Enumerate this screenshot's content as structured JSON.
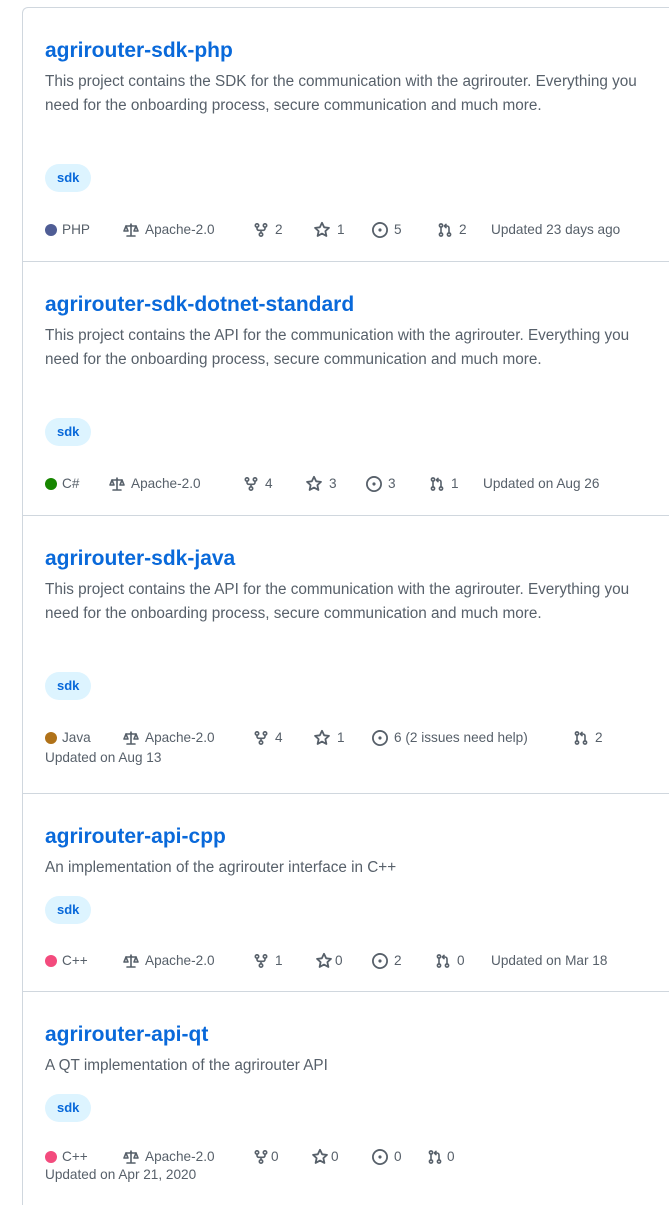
{
  "repos": [
    {
      "name": "agrirouter-sdk-php",
      "description": "This project contains the SDK for the communication with the agrirouter. Everything you need for the onboarding process, secure communication and much more.",
      "topics": [
        "sdk"
      ],
      "language": "PHP",
      "language_color": "#4f5d95",
      "license": "Apache-2.0",
      "forks": "2",
      "stars": "1",
      "issues": "5",
      "pulls": "2",
      "updated": "Updated 23 days ago"
    },
    {
      "name": "agrirouter-sdk-dotnet-standard",
      "description": "This project contains the API for the communication with the agrirouter. Everything you need for the onboarding process, secure communication and much more.",
      "topics": [
        "sdk"
      ],
      "language": "C#",
      "language_color": "#178600",
      "license": "Apache-2.0",
      "forks": "4",
      "stars": "3",
      "issues": "3",
      "pulls": "1",
      "updated": "Updated on Aug 26"
    },
    {
      "name": "agrirouter-sdk-java",
      "description": "This project contains the API for the communication with the agrirouter. Everything you need for the onboarding process, secure communication and much more.",
      "topics": [
        "sdk"
      ],
      "language": "Java",
      "language_color": "#b07219",
      "license": "Apache-2.0",
      "forks": "4",
      "stars": "1",
      "issues": "6 (2 issues need help)",
      "pulls": "2",
      "updated": "Updated on Aug 13"
    },
    {
      "name": "agrirouter-api-cpp",
      "description": "An implementation of the agrirouter interface in C++",
      "topics": [
        "sdk"
      ],
      "language": "C++",
      "language_color": "#f34b7d",
      "license": "Apache-2.0",
      "forks": "1",
      "stars": "0",
      "issues": "2",
      "pulls": "0",
      "updated": "Updated on Mar 18"
    },
    {
      "name": "agrirouter-api-qt",
      "description": "A QT implementation of the agrirouter API",
      "topics": [
        "sdk"
      ],
      "language": "C++",
      "language_color": "#f34b7d",
      "license": "Apache-2.0",
      "forks": "0",
      "stars": "0",
      "issues": "0",
      "pulls": "0",
      "updated": "Updated on Apr 21, 2020"
    }
  ]
}
